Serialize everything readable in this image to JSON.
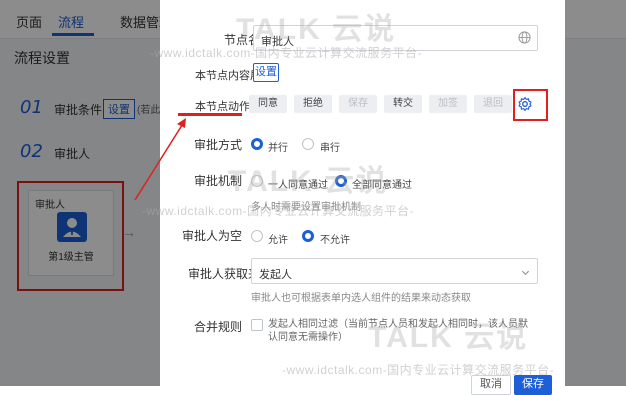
{
  "topnav": {
    "tabs": [
      "页面",
      "流程",
      "数据管理"
    ]
  },
  "background": {
    "title": "流程设置",
    "steps": [
      {
        "num": "01",
        "label": "审批条件",
        "button": "设置",
        "note": "(若此"
      },
      {
        "num": "02",
        "label": "审批人"
      }
    ],
    "node": {
      "label": "审批人",
      "caption": "第1级主管"
    }
  },
  "modal": {
    "node_name": {
      "label": "节点名称",
      "value": "审批人"
    },
    "content_display": {
      "label": "本节点内容展示",
      "button": "设置"
    },
    "action_settings": {
      "label": "本节点动作设置",
      "buttons": [
        "同意",
        "拒绝",
        "保存",
        "转交",
        "加签",
        "退回"
      ]
    },
    "approval_mode": {
      "label": "审批方式",
      "options": [
        "并行",
        "串行"
      ],
      "selected": "并行"
    },
    "approval_mechanism": {
      "label": "审批机制",
      "options": [
        "一人同意通过",
        "全部同意通过"
      ],
      "selected": "全部同意通过",
      "hint": "多人时需要设置审批机制"
    },
    "approver_empty": {
      "label": "审批人为空",
      "options": [
        "允许",
        "不允许"
      ],
      "selected": "不允许"
    },
    "approver_source": {
      "label": "审批人获取来源",
      "value": "发起人",
      "hint": "审批人也可根据表单内选人组件的结果来动态获取"
    },
    "merge_rule": {
      "label": "合并规则",
      "text": "发起人相同过滤（当前节点人员和发起人相同时，该人员默认同意无需操作）"
    },
    "footer": {
      "cancel": "取消",
      "save": "保存"
    }
  },
  "watermark": {
    "url": "-www.idctalk.com-国内专业云计算交流服务平台-",
    "brand": "TALK 云说"
  },
  "colors": {
    "accent": "#1c5fd6",
    "annotation": "#e0201d"
  }
}
